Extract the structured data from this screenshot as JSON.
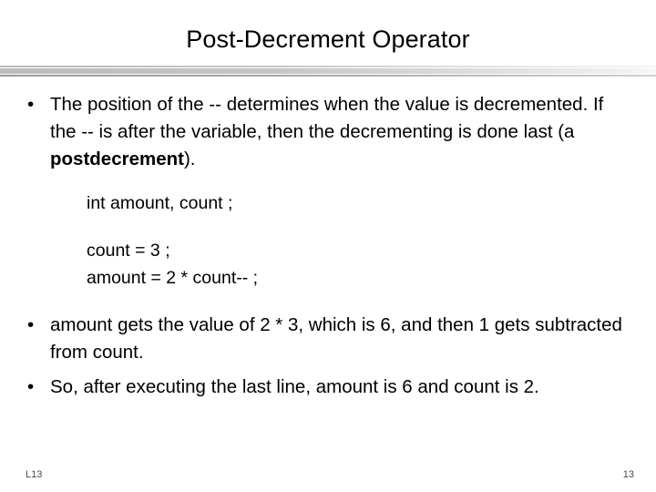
{
  "slide": {
    "title": "Post-Decrement Operator",
    "bullet_marker": "•",
    "bullets_top": [
      {
        "text_before_bold": "The position of the -- determines when the value is decremented.  If the -- is after the variable, then the decrementing is done last (a ",
        "bold": "postdecrement",
        "text_after_bold": ")."
      }
    ],
    "code": {
      "declaration": "int amount, count ;",
      "lines": [
        "count = 3 ;",
        "amount = 2 * count-- ;"
      ]
    },
    "bullets_bottom": [
      "amount gets the value of 2 * 3, which is 6, and then 1 gets subtracted from count.",
      "So, after executing the last line, amount is 6 and count is 2."
    ],
    "footer": {
      "left_label": "L13",
      "page_number": "13"
    },
    "colors": {
      "text": "#000000",
      "background": "#ffffff",
      "rule_dark": "#9a9a9a",
      "rule_light": "#f4f4f4",
      "footer_text": "#4a4a4a"
    }
  }
}
